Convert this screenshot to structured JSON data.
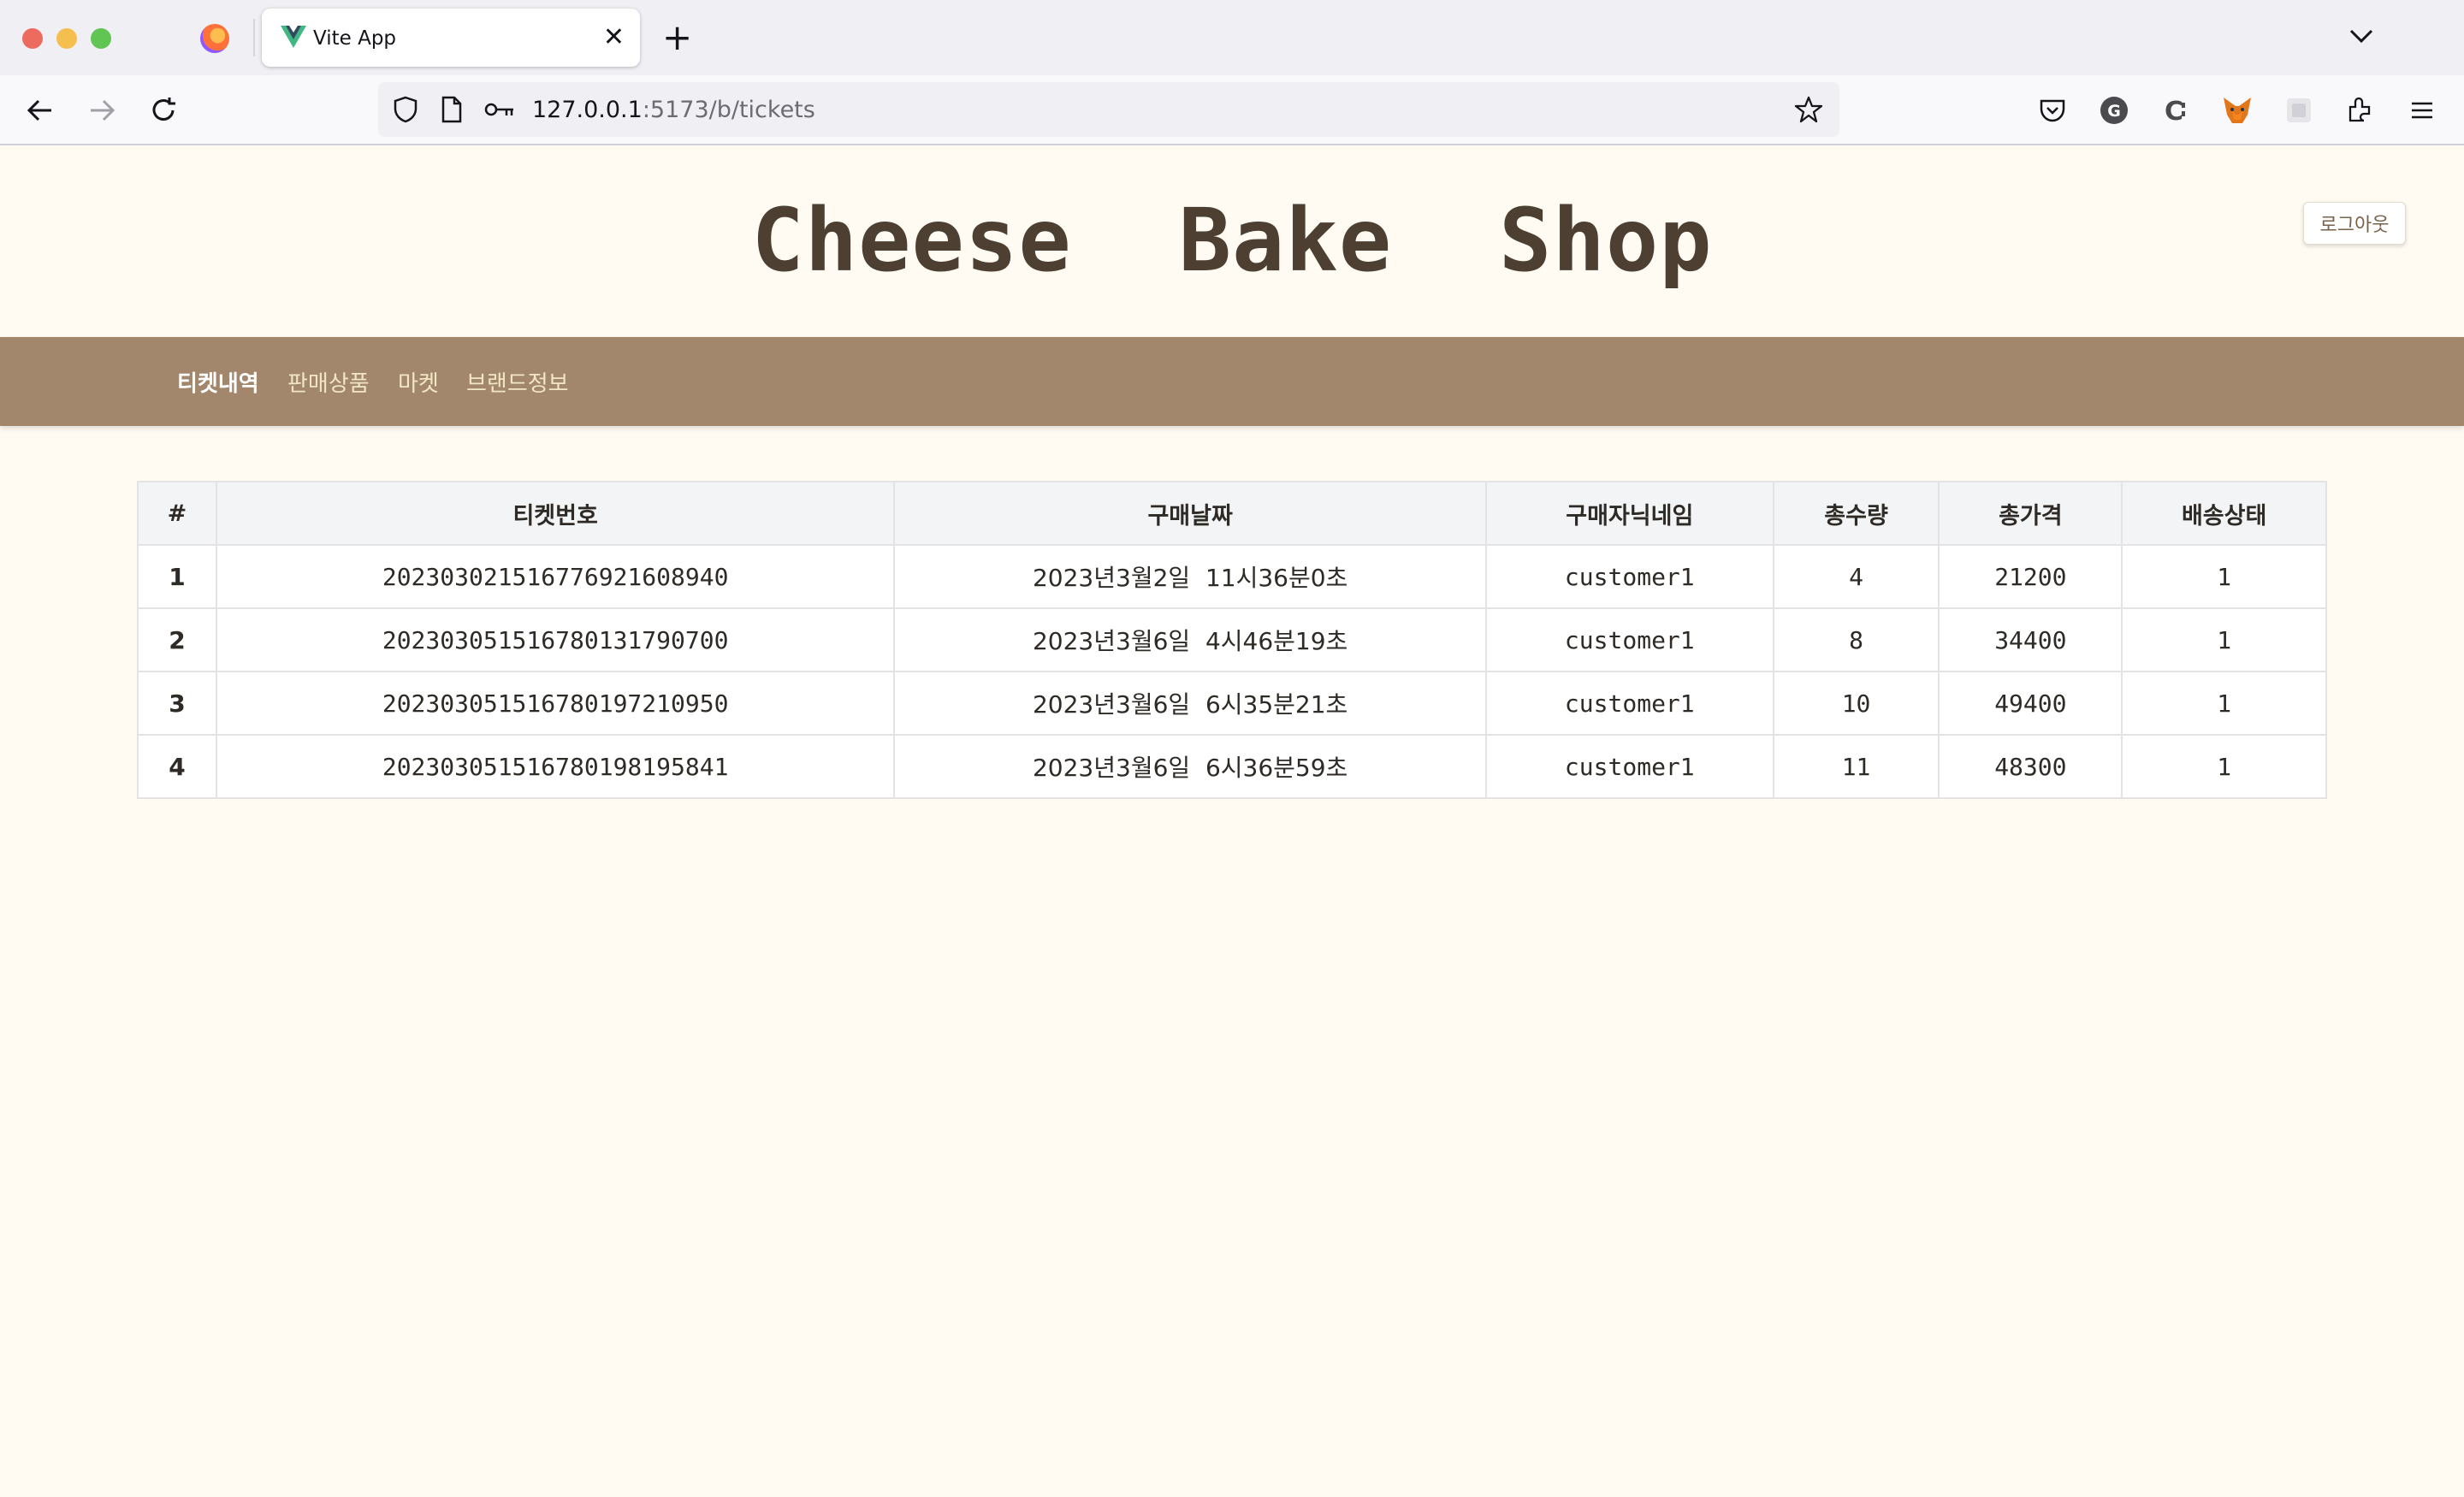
{
  "browser": {
    "tab_title": "Vite App",
    "url_host": "127.0.0.1",
    "url_rest": ":5173/b/tickets",
    "icons": [
      "back-icon",
      "forward-icon",
      "reload-icon",
      "shield-icon",
      "page-icon",
      "key-icon",
      "star-icon",
      "pocket-icon",
      "grammarly-icon",
      "extension-c-icon",
      "metamask-icon",
      "extension-icon",
      "extensions-icon",
      "menu-icon"
    ]
  },
  "header": {
    "title": "Cheese  Bake  Shop",
    "logout_label": "로그아웃"
  },
  "nav": {
    "items": [
      {
        "label": "티켓내역"
      },
      {
        "label": "판매상품"
      },
      {
        "label": "마켓"
      },
      {
        "label": "브랜드정보"
      }
    ]
  },
  "table": {
    "headers": [
      "#",
      "티켓번호",
      "구매날짜",
      "구매자닉네임",
      "총수량",
      "총가격",
      "배송상태"
    ],
    "rows": [
      [
        "1",
        "20230302151677692160894​0",
        "2023년3월2일  11시36분0초",
        "customer1",
        "4",
        "21200",
        "1"
      ],
      [
        "2",
        "202303051516780131790700",
        "2023년3월6일  4시46분19초",
        "customer1",
        "8",
        "34400",
        "1"
      ],
      [
        "3",
        "202303051516780197210950",
        "2023년3월6일  6시35분21초",
        "customer1",
        "10",
        "49400",
        "1"
      ],
      [
        "4",
        "202303051516780198195841",
        "2023년3월6일  6시36분59초",
        "customer1",
        "11",
        "48300",
        "1"
      ]
    ]
  }
}
